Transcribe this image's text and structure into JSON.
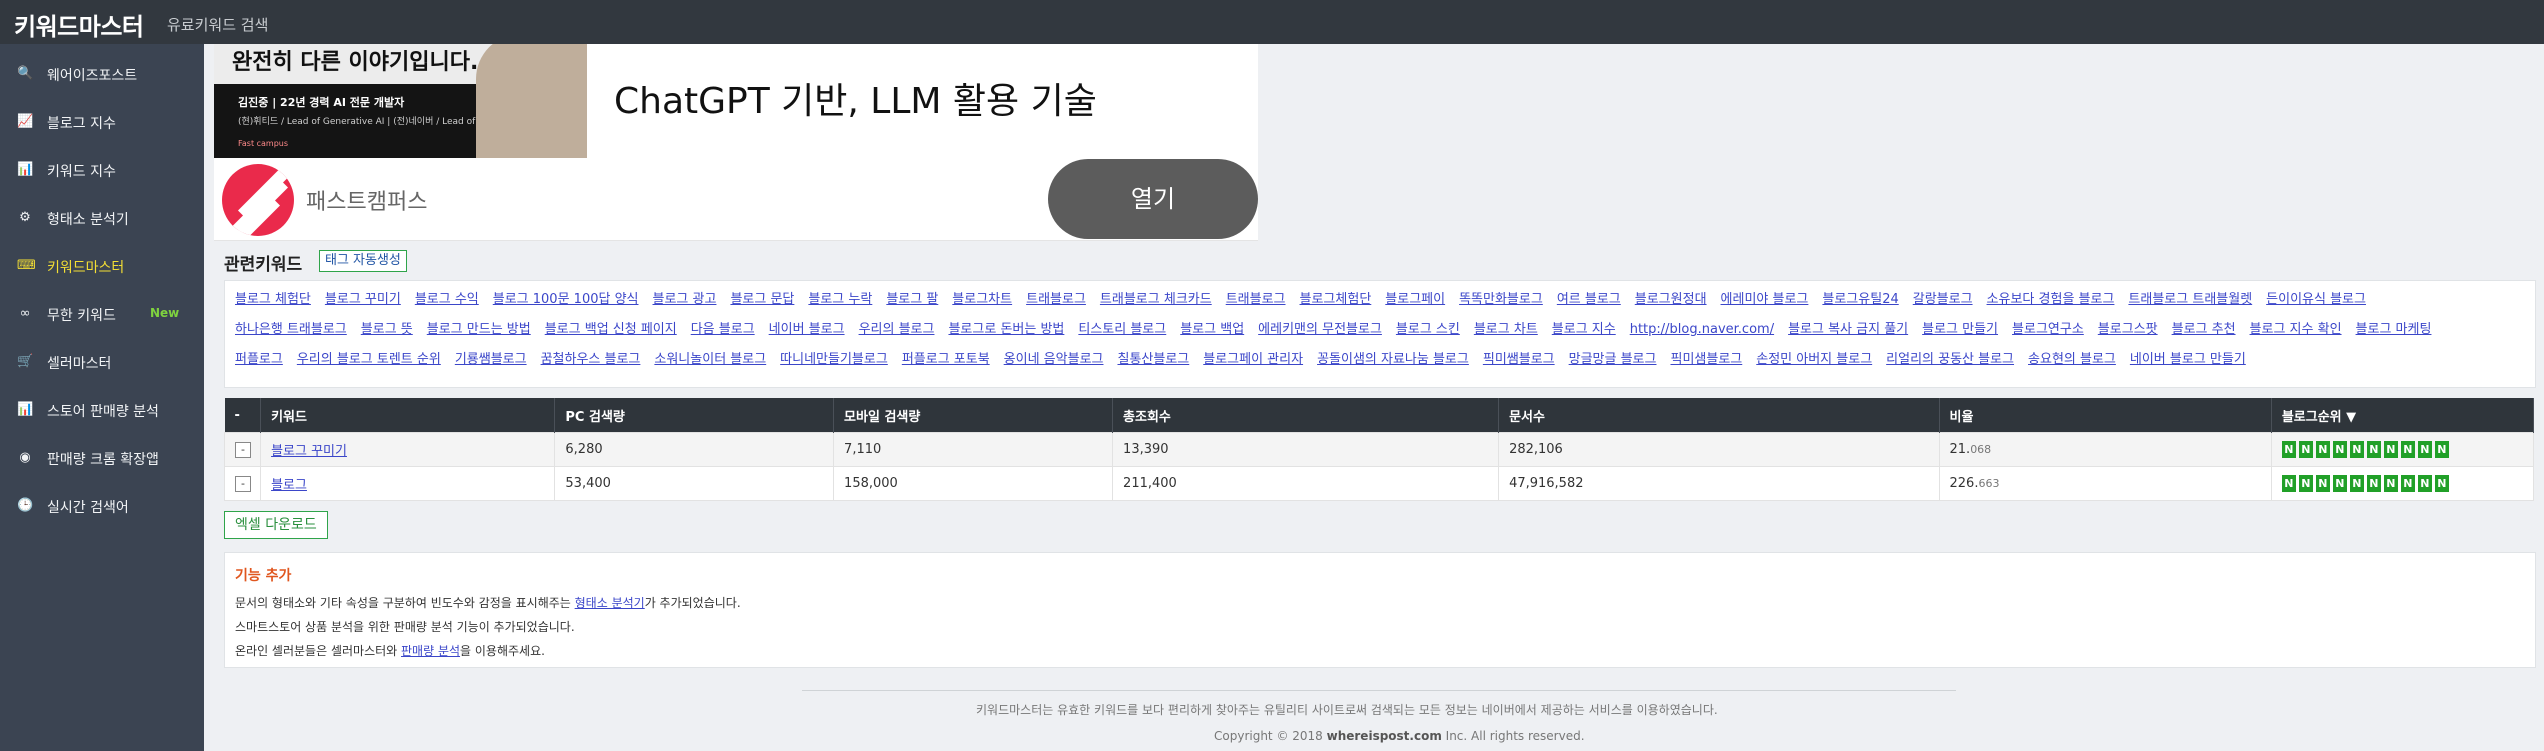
{
  "header": {
    "brand": "키워드마스터",
    "subtitle": "유료키워드 검색"
  },
  "sidebar": {
    "items": [
      {
        "icon": "search-icon",
        "glyph": "🔍",
        "label": "웨어이즈포스트"
      },
      {
        "icon": "line-chart-icon",
        "glyph": "📈",
        "label": "블로그 지수"
      },
      {
        "icon": "bar-chart-icon",
        "glyph": "📊",
        "label": "키워드 지수"
      },
      {
        "icon": "gear-icon",
        "glyph": "⚙",
        "label": "형태소 분석기"
      },
      {
        "icon": "keyboard-icon",
        "glyph": "⌨",
        "label": "키워드마스터"
      },
      {
        "icon": "infinity-icon",
        "glyph": "∞",
        "label": "무한 키워드",
        "badge": "New"
      },
      {
        "icon": "cart-icon",
        "glyph": "🛒",
        "label": "셀러마스터"
      },
      {
        "icon": "bar-chart-icon",
        "glyph": "📊",
        "label": "스토어 판매량 분석"
      },
      {
        "icon": "chrome-icon",
        "glyph": "◉",
        "label": "판매량 크롬 확장앱"
      },
      {
        "icon": "clock-icon",
        "glyph": "🕒",
        "label": "실시간 검색어"
      }
    ],
    "active_label": "키워드마스터",
    "new_color": "#7fd33f"
  },
  "ad": {
    "headline": "완전히 다른 이야기입니다.",
    "person_name": "김진중 | 22년 경력 AI 전문 개발자",
    "person_role": "(현)휘티드 / Lead of Generative AI | (전)네이버 / Lead of AI Production",
    "logos": "Fast campus",
    "title": "ChatGPT 기반, LLM 활용 기술",
    "brand": "패스트캠퍼스",
    "open_label": "열기"
  },
  "related": {
    "title": "관련키워드",
    "tag_button": "태그 자동생성",
    "lines": [
      [
        "블로그 체험단",
        "블로그 꾸미기",
        "블로그 수익",
        "블로그 100문 100답 양식",
        "블로그 광고",
        "블로그 문답",
        "블로그 누락",
        "블로그 팔",
        "블로그차트",
        "트래블로그",
        "트래블로그 체크카드",
        "트래블로그",
        "블로그체험단",
        "블로그페이",
        "똑똑만화블로그",
        "여르 블로그",
        "블로그원정대",
        "에레미야 블로그",
        "블로그유틸24",
        "갈랑블로그",
        "소유보다 경험을 블로그",
        "트래블로그 트래블월렛",
        "든이이유식 블로그"
      ],
      [
        "하나은행 트래블로그",
        "블로그 뜻",
        "블로그 만드는 방법",
        "블로그 백업 신청 페이지",
        "다음 블로그",
        "네이버 블로그",
        "우리의 블로그",
        "블로그로 돈버는 방법",
        "티스토리 블로그",
        "블로그 백업",
        "에레키맨의 무전블로그",
        "블로그 스킨",
        "블로그 차트",
        "블로그 지수",
        "http://blog.naver.com/",
        "블로그 복사 금지 풀기",
        "블로그 만들기",
        "블로그연구소",
        "블로그스팟",
        "블로그 추천",
        "블로그 지수 확인",
        "블로그 마케팅"
      ],
      [
        "퍼플로그",
        "우리의 블로그 토렌트 순위",
        "기룡쌤블로그",
        "꿈철하우스 블로그",
        "소워니놀이터 블로그",
        "따니네만들기블로그",
        "퍼플로그 포토북",
        "옹이네 음악블로그",
        "칠통산블로그",
        "블로그페이 관리자",
        "꽁돌이샘의 자료나눔 블로그",
        "픽미쌤블로그",
        "망글망글 블로그",
        "픽미샘블로그",
        "손정민 아버지 블로그",
        "리얼리의 꿍동산 블로그",
        "송요현의 블로그",
        "네이버 블로그 만들기"
      ]
    ]
  },
  "table": {
    "headers": [
      "-",
      "키워드",
      "PC 검색량",
      "모바일 검색량",
      "총조회수",
      "문서수",
      "비율",
      "블로그순위 ▼"
    ],
    "rows": [
      {
        "toggle": "-",
        "keyword": "블로그 꾸미기",
        "pc": "6,280",
        "mobile": "7,110",
        "total": "13,390",
        "docs": "282,106",
        "ratio_int": "21.",
        "ratio_dec": "068",
        "ranks": [
          "N",
          "N",
          "N",
          "N",
          "N",
          "N",
          "N",
          "N",
          "N",
          "N"
        ]
      },
      {
        "toggle": "-",
        "keyword": "블로그",
        "pc": "53,400",
        "mobile": "158,000",
        "total": "211,400",
        "docs": "47,916,582",
        "ratio_int": "226.",
        "ratio_dec": "663",
        "ranks": [
          "N",
          "N",
          "N",
          "N",
          "N",
          "N",
          "N",
          "N",
          "N",
          "N"
        ]
      }
    ],
    "rank_color": "#21a028"
  },
  "excel_button": "엑셀 다운로드",
  "feature": {
    "title": "기능 추가",
    "line1_pre": "문서의 형태소와 기타 속성을 구분하여 빈도수와 감정을 표시해주는 ",
    "line1_link": "형태소 분석기",
    "line1_post": "가 추가되었습니다.",
    "line2": "스마트스토어 상품 분석을 위한 판매량 분석 기능이 추가되었습니다.",
    "line3_pre": "온라인 셀러분들은 셀러마스터와 ",
    "line3_link": "판매량 분석",
    "line3_post": "을 이용해주세요."
  },
  "footer": {
    "line1": "키워드마스터는 유효한 키워드를 보다 편리하게 찾아주는 유틸리티 사이트로써 검색되는 모든 정보는 네이버에서 제공하는 서비스를 이용하였습니다.",
    "copyright_pre": "Copyright © 2018 ",
    "copyright_site": "whereispost.com",
    "copyright_post": " Inc. All rights reserved."
  }
}
